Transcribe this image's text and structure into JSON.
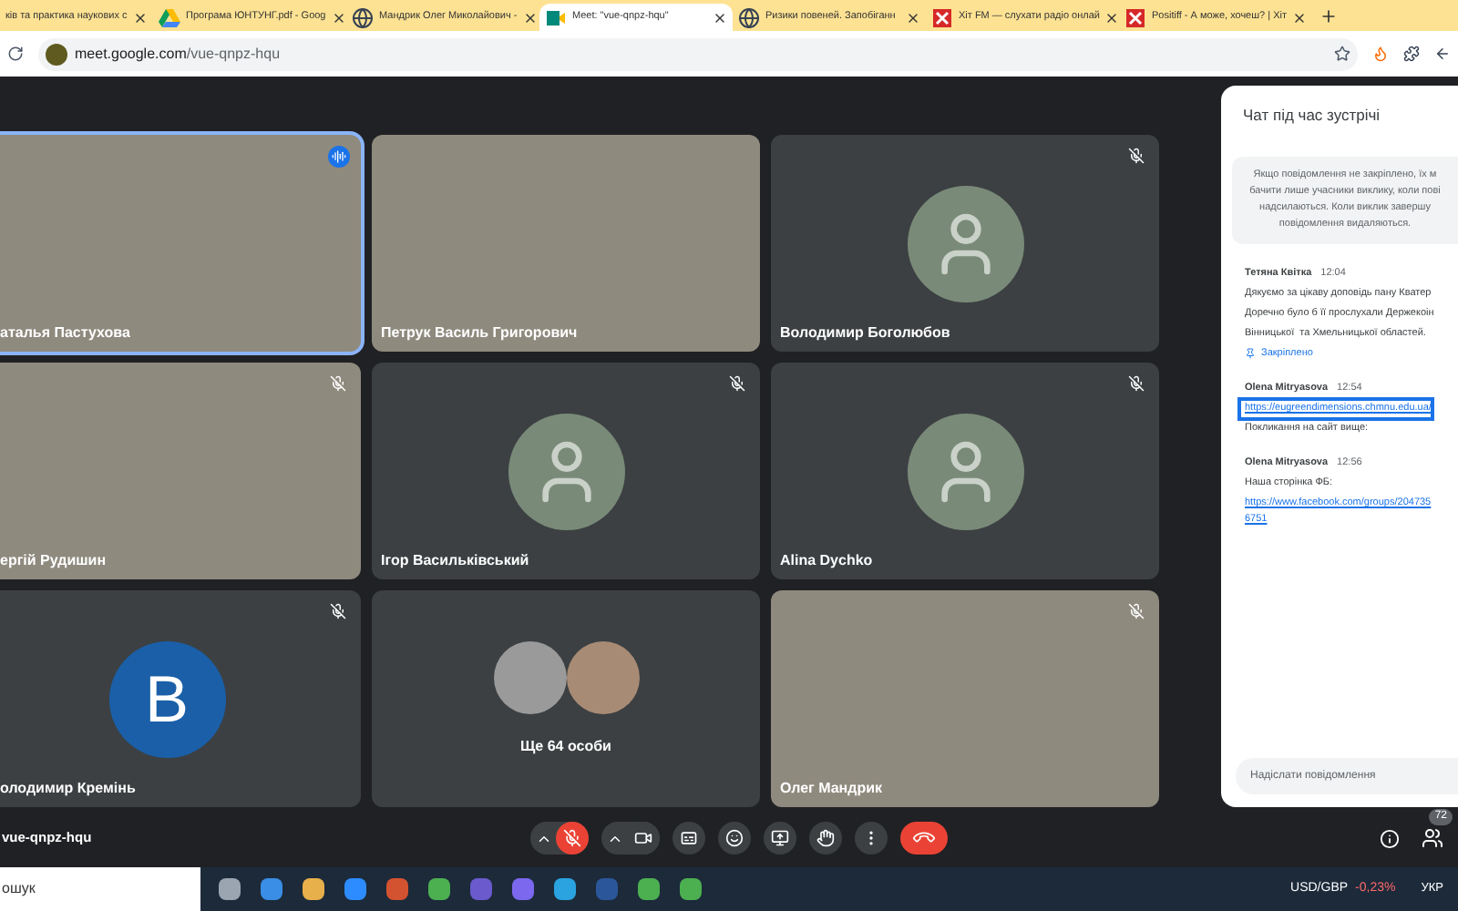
{
  "browser": {
    "tabs": [
      {
        "title": "ків та практика наукових с",
        "selected": false
      },
      {
        "title": "Програма ЮНТУНГ.pdf - Goog",
        "selected": false,
        "kind": "drive"
      },
      {
        "title": "Мандрик Олег Миколайович -",
        "selected": false,
        "kind": "web"
      },
      {
        "title": "Meet: \"vue-qnpz-hqu\"",
        "selected": true,
        "kind": "meet"
      },
      {
        "title": "Ризики повеней. Запобіганн",
        "selected": false,
        "kind": "web"
      },
      {
        "title": "Хіт FM — слухати радіо онлай",
        "selected": false,
        "kind": "radio"
      },
      {
        "title": "Positiff - А може, хочеш? | Хіт",
        "selected": false,
        "kind": "radio"
      }
    ],
    "url_host": "meet.google.com",
    "url_path": "/vue-qnpz-hqu"
  },
  "tiles": [
    {
      "name": "аталья Пастухова",
      "kind": "video",
      "muted": false,
      "speaking": true
    },
    {
      "name": "Петрук Василь Григорович",
      "kind": "video",
      "muted": false,
      "speaking": false
    },
    {
      "name": "Володимир Боголюбов",
      "kind": "avatar",
      "muted": true,
      "speaking": false
    },
    {
      "name": "ергій Рудишин",
      "kind": "video",
      "muted": true,
      "speaking": false
    },
    {
      "name": "Ігор Васильківський",
      "kind": "avatar",
      "muted": true,
      "speaking": false
    },
    {
      "name": "Alina Dychko",
      "kind": "avatar",
      "muted": true,
      "speaking": false
    },
    {
      "name": "олодимир Кремінь",
      "kind": "letter",
      "letter": "В",
      "muted": true,
      "speaking": false
    },
    {
      "name": "Ще 64 особи",
      "kind": "group",
      "muted": false,
      "speaking": false
    },
    {
      "name": "Олег Мандрик",
      "kind": "video",
      "muted": true,
      "speaking": false
    }
  ],
  "chat": {
    "title": "Чат під час зустрічі",
    "notice": [
      "Якщо повідомлення не закріплено, їх м",
      "бачити лише учасники виклику, коли пові",
      "надсилаються. Коли виклик завершу",
      "повідомлення видаляються."
    ],
    "messages": [
      {
        "sender": "Тетяна Квітка",
        "time": "12:04",
        "lines": [
          "Дякуємо за цікаву доповідь пану Кватер",
          "Доречно було б її прослухали Держекоін",
          "Вінницької  та Хмельницької областей."
        ],
        "pinned": true,
        "pin_label": "Закріплено"
      },
      {
        "sender": "Olena Mitryasova",
        "time": "12:54",
        "link": [
          "https://eugreendimensions.chmnu.edu.ua/"
        ],
        "link_highlighted": true,
        "after": [
          "Покликання на сайт вище:"
        ]
      },
      {
        "sender": "Olena Mitryasova",
        "time": "12:56",
        "lines": [
          "Наша сторінка ФБ:"
        ],
        "link": [
          "https://www.facebook.com/groups/204735",
          "6751"
        ],
        "link_highlighted": false
      }
    ],
    "input_placeholder": "Надіслати повідомлення"
  },
  "meeting_code": "vue-qnpz-hqu",
  "controls": [
    {
      "kind": "mic",
      "on": false
    },
    {
      "kind": "camera",
      "on": true
    },
    {
      "kind": "captions"
    },
    {
      "kind": "emoji"
    },
    {
      "kind": "present"
    },
    {
      "kind": "hand"
    },
    {
      "kind": "more"
    },
    {
      "kind": "end"
    }
  ],
  "people_count": "72",
  "taskbar": {
    "search_placeholder": "ошук",
    "currency": "USD/GBP",
    "change": "-0,23%",
    "language": "УКР"
  }
}
